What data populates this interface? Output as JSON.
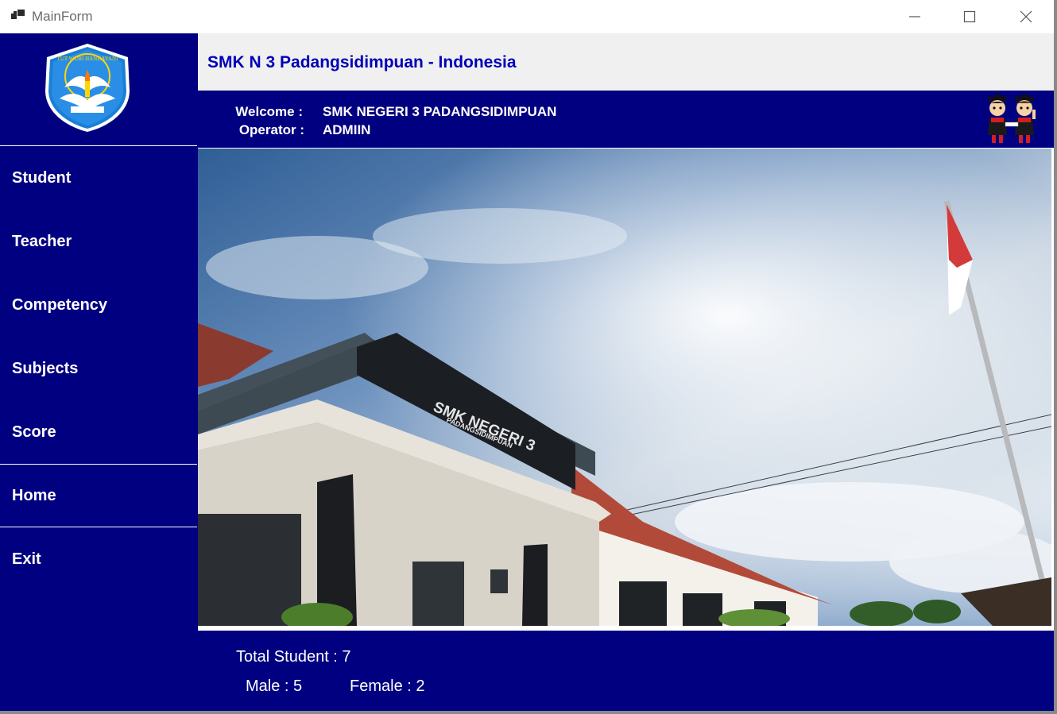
{
  "window": {
    "title": "MainForm",
    "controls": [
      "minimize-icon",
      "maximize-icon",
      "close-icon"
    ]
  },
  "header": {
    "title": "SMK N 3 Padangsidimpuan - Indonesia",
    "welcome_label": "Welcome :",
    "welcome_value": "SMK NEGERI 3 PADANGSIDIMPUAN",
    "operator_label": "Operator :",
    "operator_value": "ADMIIN"
  },
  "sidebar": {
    "logo_text": "TUT WURI HANDAYANI",
    "items": [
      {
        "label": "Student"
      },
      {
        "label": "Teacher"
      },
      {
        "label": "Competency"
      },
      {
        "label": "Subjects"
      },
      {
        "label": "Score"
      },
      {
        "label": "Home",
        "active": true
      },
      {
        "label": "Exit"
      }
    ]
  },
  "photo": {
    "building_sign": "SMK NEGERI 3",
    "building_sign_sub": "PADANGSIDIMPUAN"
  },
  "stats": {
    "total": "Total Student : 7",
    "male": "Male : 5",
    "female": "Female : 2"
  },
  "colors": {
    "navy": "#000080",
    "title_blue": "#0000b8",
    "header_gray": "#f0f0f0"
  }
}
